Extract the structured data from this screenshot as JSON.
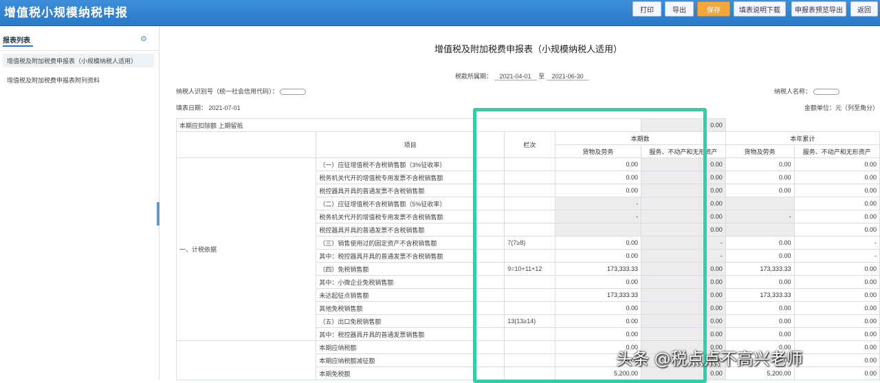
{
  "app": {
    "title": "增值税小规模纳税申报"
  },
  "toolbar": {
    "buttons": [
      "打印",
      "导出",
      "保存",
      "填表说明下载",
      "申报表预览导出",
      "返回"
    ]
  },
  "sidebar": {
    "title": "报表列表",
    "items": [
      "增值税及附加税费申报表（小规模纳税人适用）",
      "增值税及附加税费申报表附列资料"
    ]
  },
  "document": {
    "title": "增值税及附加税费申报表（小规模纳税人适用）",
    "period_label": "税款所属期：",
    "period_from": "2021-04-01",
    "period_to_label": "至",
    "period_to": "2021-06-30",
    "taxpayer_id_label": "纳税人识别号（统一社会信用代码）：",
    "taxpayer_name_label": "纳税人名称：",
    "fill_date_label": "填表日期：",
    "fill_date": "2021-07-01",
    "unit_label": "金额单位：元（列至角分）",
    "deduct_label": "本期应扣除额 上期留抵",
    "deduct_value": "0.00"
  },
  "table": {
    "col_item": "项目",
    "col_line": "栏次",
    "group_current": "本期数",
    "group_ytd": "本年累计",
    "sub_goods": "货物及劳务",
    "sub_service": "服务、不动产和无形资产",
    "section_tax_basis": "一、计税依据",
    "rows": [
      {
        "label": "（一）应征增值税不含税销售额（3%征收率）",
        "line": "",
        "a": "0.00",
        "b": "0.00",
        "c": "0.00",
        "d": "0.00",
        "ga": false
      },
      {
        "label": "税务机关代开的增值税专用发票不含税销售额",
        "line": "",
        "a": "0.00",
        "b": "0.00",
        "c": "0.00",
        "d": "0.00",
        "ga": false
      },
      {
        "label": "税控器具开具的普通发票不含税销售额",
        "line": "",
        "a": "0.00",
        "b": "0.00",
        "c": "0.00",
        "d": "0.00",
        "ga": false
      },
      {
        "label": "（二）应征增值税不含税销售额（5%征收率）",
        "line": "",
        "a": "-",
        "b": "0.00",
        "c": "",
        "d": "0.00",
        "ga": true
      },
      {
        "label": "税务机关代开的增值税专用发票不含税销售额",
        "line": "",
        "a": "-",
        "b": "0.00",
        "c": "-",
        "d": "0.00",
        "ga": true
      },
      {
        "label": "税控器具开具的普通发票不含税销售额",
        "line": "",
        "a": "",
        "b": "0.00",
        "c": "",
        "d": "0.00",
        "ga": true
      },
      {
        "label": "（三）销售使用过的固定资产不含税销售额",
        "line": "7(7≥8)",
        "a": "0.00",
        "b": "-",
        "c": "0.00",
        "d": "-",
        "ga": false
      },
      {
        "label": "其中：税控器具开具的普通发票不含税销售额",
        "line": "",
        "a": "0.00",
        "b": "-",
        "c": "0.00",
        "d": "-",
        "ga": false
      },
      {
        "label": "（四）免税销售额",
        "line": "9=10+11+12",
        "a": "173,333.33",
        "b": "0.00",
        "c": "173,333.33",
        "d": "0.00",
        "ga": false
      },
      {
        "label": "其中：小微企业免税销售额",
        "line": "",
        "a": "0.00",
        "b": "0.00",
        "c": "0.00",
        "d": "0.00",
        "ga": false
      },
      {
        "label": "未达起征点销售额",
        "line": "",
        "a": "173,333.33",
        "b": "0.00",
        "c": "173,333.33",
        "d": "0.00",
        "ga": false
      },
      {
        "label": "其他免税销售额",
        "line": "",
        "a": "0.00",
        "b": "0.00",
        "c": "0.00",
        "d": "0.00",
        "ga": false
      },
      {
        "label": "（五）出口免税销售额",
        "line": "13(13≥14)",
        "a": "0.00",
        "b": "0.00",
        "c": "0.00",
        "d": "0.00",
        "ga": false
      },
      {
        "label": "其中：税控器具开具的普通发票销售额",
        "line": "",
        "a": "0.00",
        "b": "0.00",
        "c": "0.00",
        "d": "0.00",
        "ga": false
      },
      {
        "label": "本期应纳税额",
        "line": "",
        "a": "0.00",
        "b": "0.00",
        "c": "0.00",
        "d": "0.00",
        "ga": false
      },
      {
        "label": "本期应纳税额减征额",
        "line": "",
        "a": "0.00",
        "b": "0.00",
        "c": "0.00",
        "d": "0.00",
        "ga": false
      },
      {
        "label": "本期免税额",
        "line": "",
        "a": "5,200.00",
        "b": "0.00",
        "c": "5,200.00",
        "d": "0.00",
        "ga": false
      }
    ]
  },
  "watermark": "头条 @税点点不高兴老师",
  "colors": {
    "topbar": "#2a78c8",
    "highlight": "#2fd0a8",
    "active_button": "#f2a73a"
  }
}
